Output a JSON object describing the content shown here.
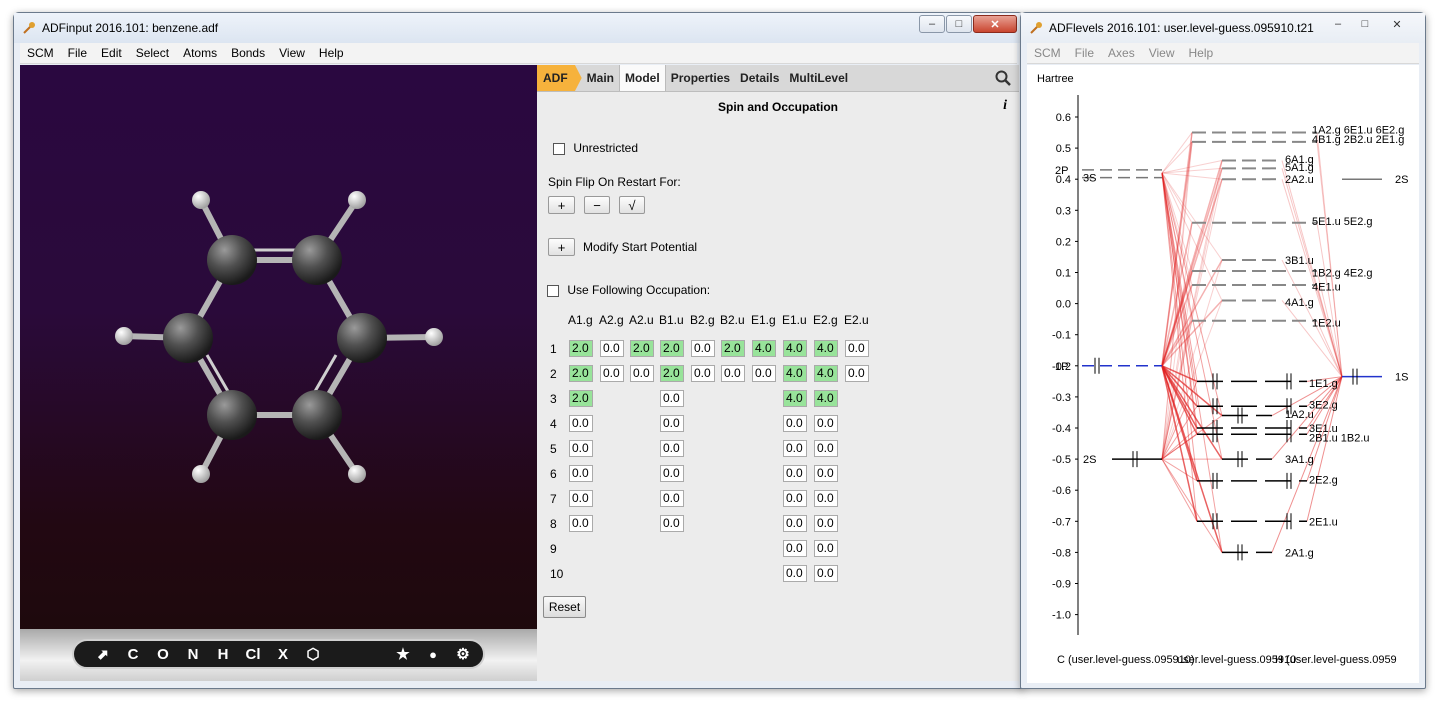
{
  "left_window": {
    "title": "ADFinput 2016.101: benzene.adf",
    "menu": [
      "SCM",
      "File",
      "Edit",
      "Select",
      "Atoms",
      "Bonds",
      "View",
      "Help"
    ],
    "toolbar": [
      "C",
      "O",
      "N",
      "H",
      "Cl",
      "X"
    ],
    "tabs": [
      "ADF",
      "Main",
      "Model",
      "Properties",
      "Details",
      "MultiLevel"
    ],
    "active_tab": "Model",
    "section_title": "Spin and Occupation",
    "unrestricted_label": "Unrestricted",
    "spin_flip_label": "Spin Flip On Restart For:",
    "spin_buttons": [
      "+",
      "−",
      "√"
    ],
    "modify_btn": "+",
    "modify_label": "Modify Start Potential",
    "use_occ_label": "Use Following Occupation:",
    "irreps": [
      "A1.g",
      "A2.g",
      "A2.u",
      "B1.u",
      "B2.g",
      "B2.u",
      "E1.g",
      "E1.u",
      "E2.g",
      "E2.u"
    ],
    "rows": [
      "1",
      "2",
      "3",
      "4",
      "5",
      "6",
      "7",
      "8",
      "9",
      "10"
    ],
    "occupation": [
      [
        "2.0",
        "0.0",
        "2.0",
        "2.0",
        "0.0",
        "2.0",
        "4.0",
        "4.0",
        "4.0",
        "0.0"
      ],
      [
        "2.0",
        "0.0",
        "0.0",
        "2.0",
        "0.0",
        "0.0",
        "0.0",
        "4.0",
        "4.0",
        "0.0"
      ],
      [
        "2.0",
        "",
        "",
        "0.0",
        "",
        "",
        "",
        "4.0",
        "4.0",
        ""
      ],
      [
        "0.0",
        "",
        "",
        "0.0",
        "",
        "",
        "",
        "0.0",
        "0.0",
        ""
      ],
      [
        "0.0",
        "",
        "",
        "0.0",
        "",
        "",
        "",
        "0.0",
        "0.0",
        ""
      ],
      [
        "0.0",
        "",
        "",
        "0.0",
        "",
        "",
        "",
        "0.0",
        "0.0",
        ""
      ],
      [
        "0.0",
        "",
        "",
        "0.0",
        "",
        "",
        "",
        "0.0",
        "0.0",
        ""
      ],
      [
        "0.0",
        "",
        "",
        "0.0",
        "",
        "",
        "",
        "0.0",
        "0.0",
        ""
      ],
      [
        "",
        "",
        "",
        "",
        "",
        "",
        "",
        "0.0",
        "0.0",
        ""
      ],
      [
        "",
        "",
        "",
        "",
        "",
        "",
        "",
        "0.0",
        "0.0",
        ""
      ]
    ],
    "green": [
      [
        1,
        0,
        1,
        1,
        0,
        1,
        1,
        1,
        1,
        0
      ],
      [
        1,
        0,
        0,
        1,
        0,
        0,
        0,
        1,
        1,
        0
      ],
      [
        1,
        0,
        0,
        0,
        0,
        0,
        0,
        1,
        1,
        0
      ]
    ],
    "reset_label": "Reset",
    "colors": {
      "accent": "#f6b23c",
      "green": "#98e39a"
    }
  },
  "right_window": {
    "title": "ADFlevels 2016.101: user.level-guess.095910.t21",
    "menu": [
      "SCM",
      "File",
      "Axes",
      "View",
      "Help"
    ],
    "unit_label": "Hartree",
    "ticks": [
      "0.6",
      "0.5",
      "0.4",
      "0.3",
      "0.2",
      "0.1",
      "0.0",
      "-0.1",
      "-0.2",
      "-0.3",
      "-0.4",
      "-0.5",
      "-0.6",
      "-0.7",
      "-0.8",
      "-0.9",
      "-1.0"
    ],
    "bottom_text": "C (user.level-guess.095910)",
    "bottom_text2": "user.level-guess.095910",
    "bottom_text3": "H (user.level-guess.0959",
    "left_labels": [
      "2P",
      "3S",
      "1P",
      "2S"
    ],
    "right_labels": [
      "2S",
      "1S"
    ],
    "mo_labels": [
      "1A2.g 6E1.u 6E2.g",
      "4B1.g 2B2.u 2E1.g",
      "6A1.g",
      "5A1.g",
      "2A2.u",
      "5E1.u 5E2.g",
      "3B1.u",
      "1B2.g 4E2.g",
      "4E1.u",
      "4A1.g",
      "1E2.u",
      "1E1.g",
      "3E2.g",
      "1A2.u",
      "3E1.u",
      "2B1.u 1B2.u",
      "3A1.g",
      "2E2.g",
      "2E1.u",
      "2A1.g"
    ]
  }
}
